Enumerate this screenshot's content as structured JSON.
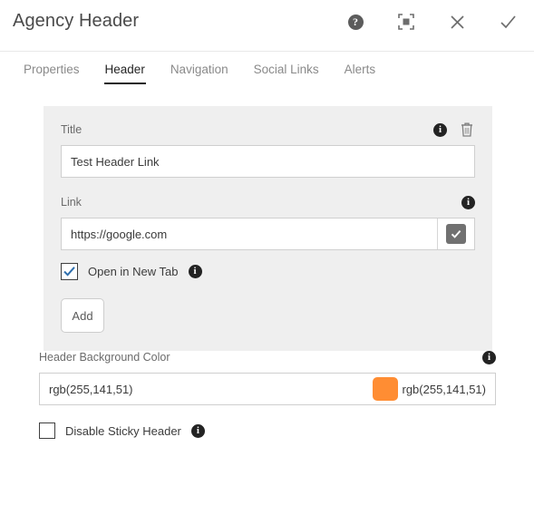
{
  "window": {
    "title": "Agency Header",
    "actions": [
      {
        "name": "help-icon",
        "label": "?"
      },
      {
        "name": "fullscreen-icon",
        "label": ""
      },
      {
        "name": "close-icon",
        "label": ""
      },
      {
        "name": "confirm-icon",
        "label": ""
      }
    ]
  },
  "tabs": [
    {
      "label": "Properties",
      "active": false
    },
    {
      "label": "Header",
      "active": true
    },
    {
      "label": "Navigation",
      "active": false
    },
    {
      "label": "Social Links",
      "active": false
    },
    {
      "label": "Alerts",
      "active": false
    }
  ],
  "repeater": {
    "title_field": {
      "label": "Title",
      "value": "Test Header Link",
      "placeholder": ""
    },
    "link_field": {
      "label": "Link",
      "value": "https://google.com",
      "placeholder": ""
    },
    "open_new_tab": {
      "label": "Open in New Tab",
      "checked": true
    },
    "add_button": {
      "label": "Add"
    },
    "info_glyph": "i",
    "trash_name": "delete-item"
  },
  "background_color": {
    "label": "Header Background Color",
    "value": "rgb(255,141,51)",
    "echo": "rgb(255,141,51)",
    "swatch_hex": "#ff8d33"
  },
  "disable_sticky": {
    "label": "Disable Sticky Header",
    "checked": false
  },
  "colors": {
    "panel_bg": "#efefef",
    "accent_orange": "#ff8d33",
    "checkbox_check": "#2f6fad",
    "tab_active": "#232323"
  }
}
